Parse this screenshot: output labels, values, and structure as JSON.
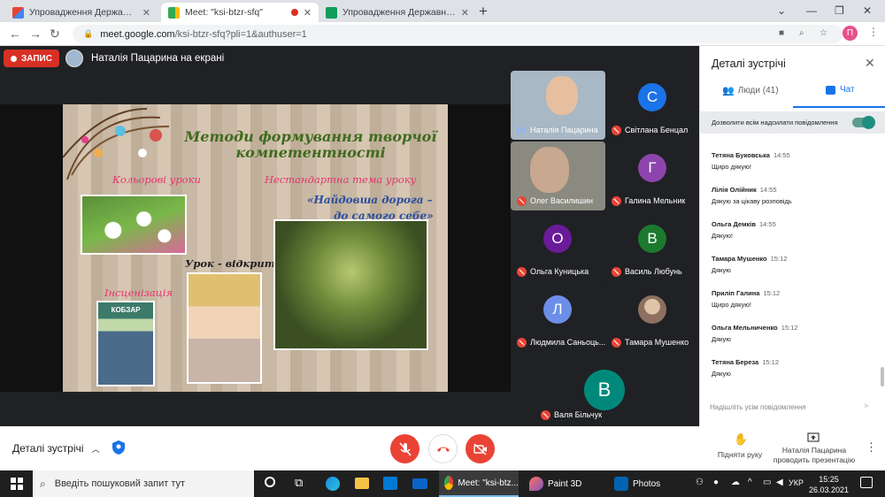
{
  "browser": {
    "tabs": [
      {
        "title": "Упровадження Державного ста",
        "favicon": "gmail-icon"
      },
      {
        "title": "Meet: \"ksi-btzr-sfq\"",
        "favicon": "meet-icon",
        "recording": true
      },
      {
        "title": "Упровадження Державного ста",
        "favicon": "sheets-icon"
      }
    ],
    "url_host": "meet.google.com",
    "url_path": "/ksi-btzr-sfq?pli=1&authuser=1",
    "profile_initial": "П"
  },
  "meet": {
    "recording_label": "ЗАПИС",
    "presenting_label": "Наталія Пацарина на екрані",
    "slide": {
      "title": "Методи формування творчої компетентності",
      "item1": "Кольорові уроки",
      "item2": "Нестандартна тема уроку",
      "quote1": "«Найдовша дорога –",
      "quote2": "до самого себе»",
      "item3": "Урок - відкриття",
      "item4": "Інсценізація",
      "book_text": "КОБЗАР"
    },
    "participants": [
      {
        "name": "Наталія Пацарина",
        "initial": "",
        "color": "",
        "video": true,
        "speaking": true
      },
      {
        "name": "Світлана Бенцал",
        "initial": "С",
        "color": "#1a73e8"
      },
      {
        "name": "Олег Василишин",
        "initial": "",
        "color": "",
        "video": true
      },
      {
        "name": "Галина Мельник",
        "initial": "Г",
        "color": "#8e44ad"
      },
      {
        "name": "Ольга Куницька",
        "initial": "О",
        "color": "#6a1b9a"
      },
      {
        "name": "Василь Любунь",
        "initial": "В",
        "color": "#1b7a2e"
      },
      {
        "name": "Людмила Саньоць...",
        "initial": "Л",
        "color": "#6c8ee8"
      },
      {
        "name": "Тамара Мушенко",
        "initial": "",
        "color": "",
        "photo": true
      },
      {
        "name": "Валя Більчук",
        "initial": "В",
        "color": "#00897b"
      }
    ]
  },
  "controls": {
    "details_label": "Деталі зустрічі",
    "raise_hand_label": "Підняти руку",
    "presenting_label_line1": "Наталія Пацарина",
    "presenting_label_line2": "проводить презентацію"
  },
  "side_panel": {
    "title": "Деталі зустрічі",
    "people_tab": "Люди (41)",
    "chat_tab": "Чат",
    "allow_label": "Дозволити всім надсилати повідомлення",
    "messages": [
      {
        "author": "Тетяна Буковська",
        "time": "14:55",
        "text": "Щиро дякую!"
      },
      {
        "author": "Лілія Олійник",
        "time": "14:55",
        "text": "Дякую за цікаву розповідь"
      },
      {
        "author": "Ольга Демків",
        "time": "14:55",
        "text": "Дякую!"
      },
      {
        "author": "Тамара Мушенко",
        "time": "15:12",
        "text": "Дякую"
      },
      {
        "author": "Приліп Галина",
        "time": "15:12",
        "text": "Щиро дякую!"
      },
      {
        "author": "Ольга Мельниченко",
        "time": "15:12",
        "text": "Дякую"
      },
      {
        "author": "Тетяна Береза",
        "time": "15:12",
        "text": "Дякую"
      }
    ],
    "input_placeholder": "Надішліть усім повідомлення"
  },
  "taskbar": {
    "search_placeholder": "Введіть пошуковий запит тут",
    "apps": [
      {
        "label": "Meet: \"ksi-btz...",
        "icon": "chrome-icon"
      },
      {
        "label": "Paint 3D",
        "icon": "paint3d-icon"
      },
      {
        "label": "Photos",
        "icon": "photos-icon"
      }
    ],
    "language": "УКР",
    "time": "15:25",
    "date": "26.03.2021"
  }
}
